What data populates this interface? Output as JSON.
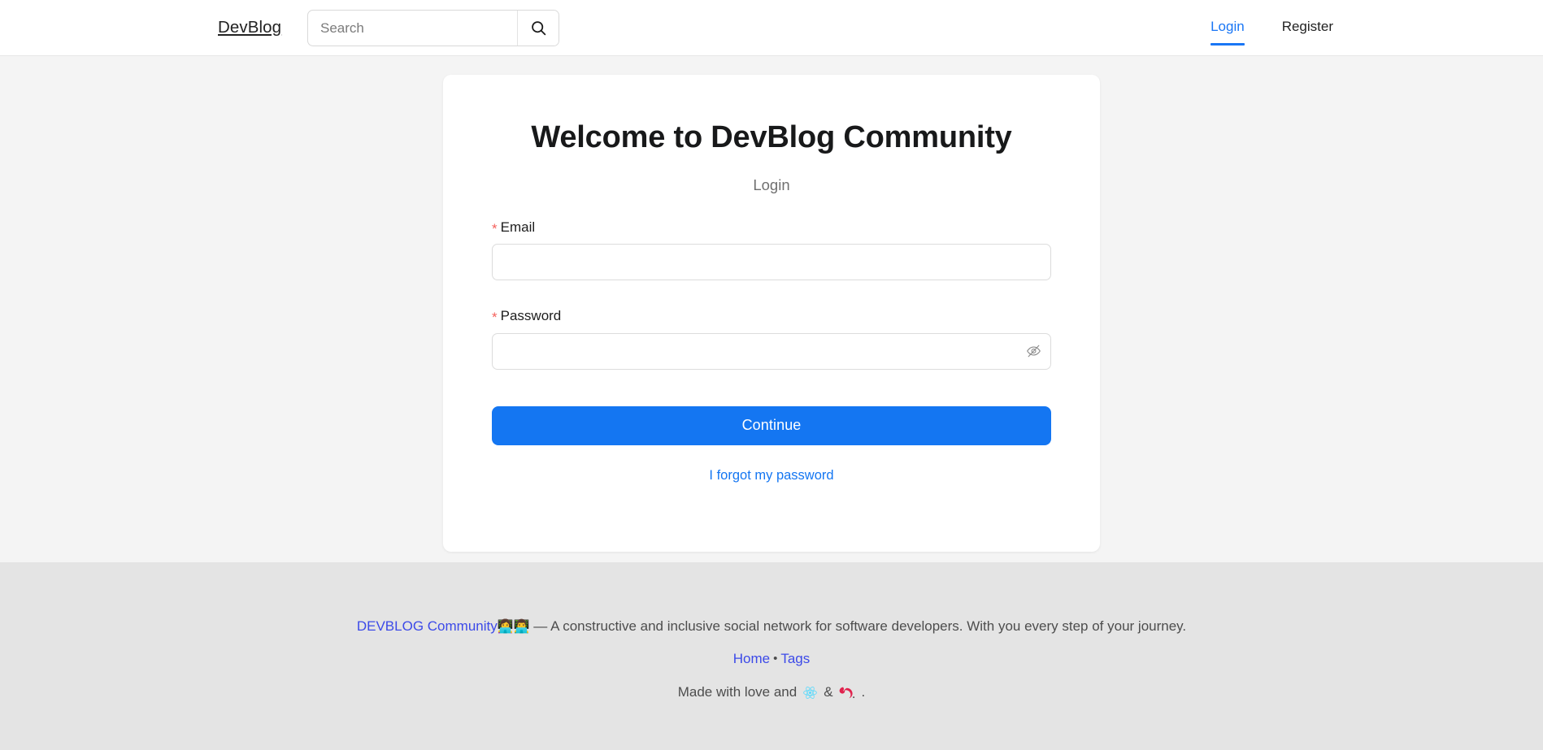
{
  "header": {
    "brand": "DevBlog",
    "search": {
      "placeholder": "Search",
      "value": "",
      "icon": "search-icon"
    },
    "nav": [
      {
        "label": "Login",
        "active": true,
        "color": "#1976f5"
      },
      {
        "label": "Register",
        "active": false,
        "color": "#222222"
      }
    ]
  },
  "auth_card": {
    "title": "Welcome to DevBlog Community",
    "subtitle": "Login",
    "required_marker": "*",
    "fields": [
      {
        "label": "Email",
        "value": "",
        "placeholder": "",
        "required": true,
        "type": "email"
      },
      {
        "label": "Password",
        "value": "",
        "placeholder": "",
        "required": true,
        "type": "password",
        "toggle_icon": "eye-off-icon"
      }
    ],
    "submit_label": "Continue",
    "forgot_label": "I forgot my password"
  },
  "footer": {
    "brand_link": "DEVBLOG Community",
    "brand_emoji": "👩‍💻👨‍💻",
    "tagline": " — A constructive and inclusive social network for software developers. With you every step of your journey.",
    "links": [
      {
        "label": "Home"
      },
      {
        "label": "Tags"
      }
    ],
    "separator": "•",
    "made_with_prefix": "Made with love and",
    "made_with_joiner": "&",
    "made_with_suffix": ".",
    "tech_logos": [
      {
        "name": "react-logo",
        "color": "#61dafb"
      },
      {
        "name": "nestjs-logo",
        "color": "#e0234e"
      }
    ]
  },
  "colors": {
    "accent": "#1476f2",
    "page_background": "#f4f4f4",
    "footer_background": "#e4e4e4",
    "card_background": "#ffffff",
    "required_star": "#f5615c",
    "footer_link": "#3c4ae8"
  }
}
